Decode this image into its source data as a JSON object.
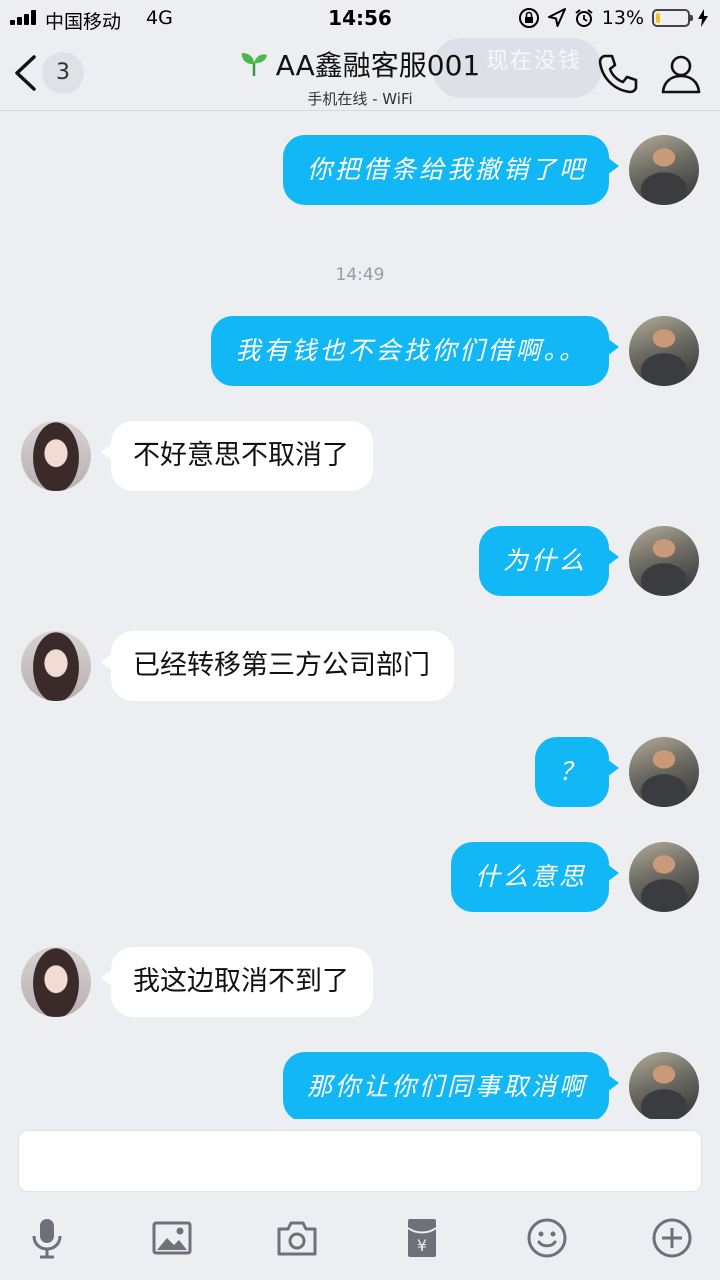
{
  "status_bar": {
    "carrier": "中国移动",
    "network": "4G",
    "time": "14:56",
    "battery_percent": "13%",
    "battery_level": 0.13,
    "battery_color": "#f4c21a"
  },
  "nav": {
    "back_badge": "3",
    "ghost_text": "现在没钱",
    "title": "AA鑫融客服001",
    "subtitle": "手机在线 - WiFi"
  },
  "colors": {
    "accent_blue": "#12b7f5",
    "background": "#eceef2"
  },
  "messages": [
    {
      "type": "out",
      "text": "你把借条给我撤销了吧"
    },
    {
      "type": "time",
      "text": "14:49"
    },
    {
      "type": "out",
      "text": "我有钱也不会找你们借啊。。"
    },
    {
      "type": "in",
      "text": "不好意思不取消了"
    },
    {
      "type": "out",
      "text": "为什么"
    },
    {
      "type": "in",
      "text": "已经转移第三方公司部门"
    },
    {
      "type": "out",
      "text": "？"
    },
    {
      "type": "out",
      "text": "什么意思"
    },
    {
      "type": "in",
      "text": "我这边取消不到了"
    },
    {
      "type": "out",
      "text": "那你让你们同事取消啊"
    }
  ],
  "input": {
    "value": ""
  },
  "toolbar": {
    "icons": [
      "microphone-icon",
      "image-icon",
      "camera-icon",
      "red-packet-icon",
      "emoji-icon",
      "plus-icon"
    ]
  }
}
